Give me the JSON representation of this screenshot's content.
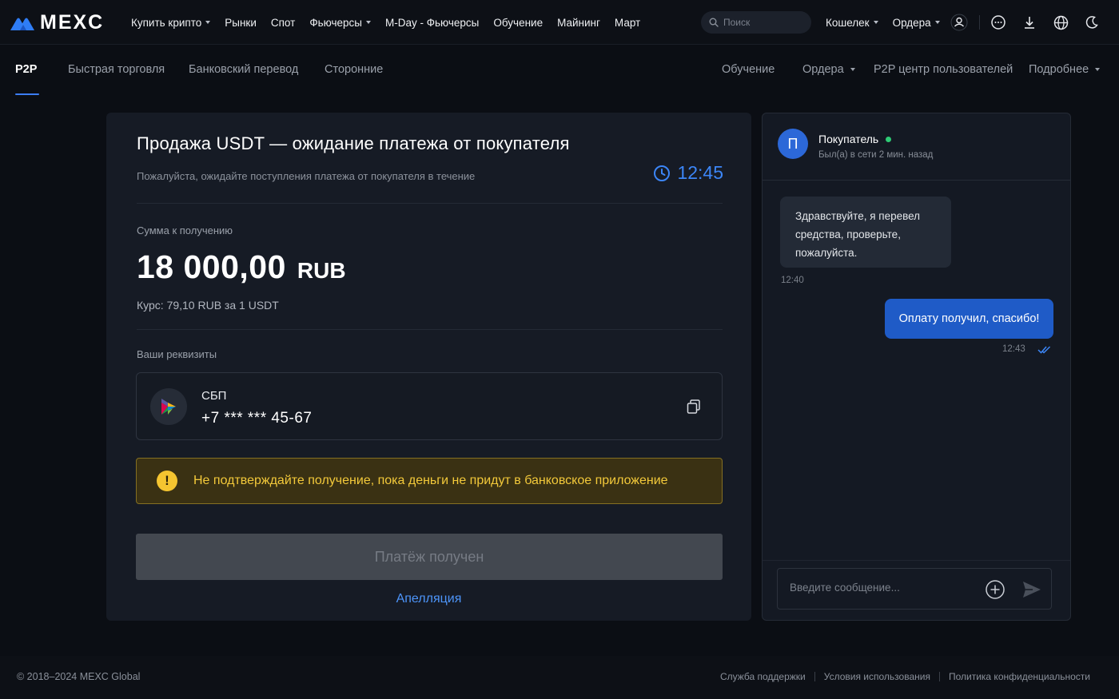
{
  "brand": {
    "name": "MEXC",
    "accent": "#3c7df5"
  },
  "header": {
    "nav": [
      {
        "label": "Купить крипто",
        "dropdown": true
      },
      {
        "label": "Рынки",
        "dropdown": false
      },
      {
        "label": "Спот",
        "dropdown": false
      },
      {
        "label": "Фьючерсы",
        "dropdown": true
      },
      {
        "label": "M-Day - Фьючерсы",
        "dropdown": false
      },
      {
        "label": "Обучение",
        "dropdown": false
      },
      {
        "label": "Майнинг",
        "dropdown": false
      },
      {
        "label": "Март",
        "dropdown": false
      }
    ],
    "search_placeholder": "Поиск",
    "wallet_label": "Кошелек",
    "orders_label": "Ордера",
    "icons": [
      "user-icon",
      "chat-bubble-icon",
      "download-icon",
      "globe-icon",
      "moon-icon"
    ]
  },
  "subnav": {
    "left": [
      "P2P",
      "Быстрая торговля",
      "Банковский перевод",
      "Сторонние"
    ],
    "active": "P2P",
    "right": {
      "learn": "Обучение",
      "orders": "Ордера",
      "user_center": "P2P центр пользователей",
      "more": "Подробнее"
    }
  },
  "order": {
    "title": "Продажа USDT — ожидание платежа от покупателя",
    "subtitle": "Пожалуйста, ожидайте поступления платежа от покупателя в течение",
    "timer": "12:45",
    "amount_label": "Сумма к получению",
    "amount": "18 000,00",
    "currency": "RUB",
    "rate": "Курс: 79,10 RUB за 1 USDT",
    "details_label": "Ваши реквизиты",
    "payment_method": "СБП",
    "payment_number": "+7 *** *** 45-67",
    "warning": "Не подтверждайте получение, пока деньги не придут в банковское приложение",
    "confirm_button": "Платёж получен",
    "appeal_link": "Апелляция"
  },
  "chat": {
    "avatar_letter": "П",
    "name": "Покупатель",
    "online": true,
    "status": "Был(а) в сети 2 мин. назад",
    "messages": [
      {
        "from": "buyer",
        "text": "Здравствуйте, я перевел средства, проверьте, пожалуйста.",
        "time": "12:40"
      },
      {
        "from": "me",
        "text": "Оплату получил, спасибо!",
        "time": "12:43",
        "read": true
      }
    ],
    "input_placeholder": "Введите сообщение..."
  },
  "footer": {
    "copyright": "© 2018–2024 MEXC Global",
    "links": [
      "Служба поддержки",
      "Условия использования",
      "Политика конфиденциальности"
    ]
  }
}
